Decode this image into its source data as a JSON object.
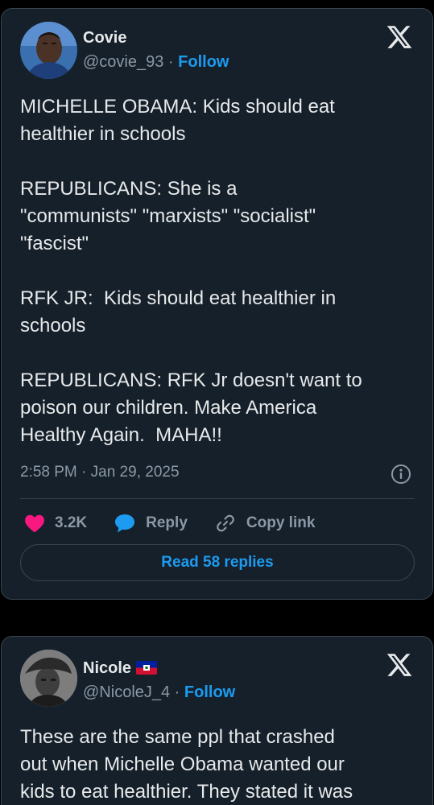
{
  "tweet1": {
    "author_name": "Covie",
    "handle": "@covie_93",
    "separator": " · ",
    "follow_label": "Follow",
    "text": "MICHELLE OBAMA: Kids should eat\nhealthier in schools\n\nREPUBLICANS: She is a\n\"communists\" \"marxists\" \"socialist\"\n\"fascist\"\n\nRFK JR:  Kids should eat healthier in\nschools\n\nREPUBLICANS: RFK Jr doesn't want to\npoison our children. Make America\nHealthy Again.  MAHA!!",
    "timestamp": "2:58 PM · Jan 29, 2025",
    "likes_count": "3.2K",
    "reply_label": "Reply",
    "copy_link_label": "Copy link",
    "read_replies_label": "Read 58 replies"
  },
  "tweet2": {
    "author_name": "Nicole",
    "handle": "@NicoleJ_4",
    "separator": " · ",
    "follow_label": "Follow",
    "text": "These are the same ppl that crashed\nout when Michelle Obama wanted our\nkids to eat healthier. They stated it was"
  },
  "icons": {
    "logo": "x-logo-icon",
    "info": "info-icon",
    "like": "heart-icon",
    "reply": "speech-bubble-icon",
    "copy": "link-icon",
    "flag": "haiti-flag-icon"
  },
  "colors": {
    "background": "#000000",
    "card": "#15202b",
    "border": "#38444d",
    "text": "#e7e9ea",
    "muted": "#8b98a5",
    "accent": "#1d9bf0",
    "like": "#f91880"
  }
}
